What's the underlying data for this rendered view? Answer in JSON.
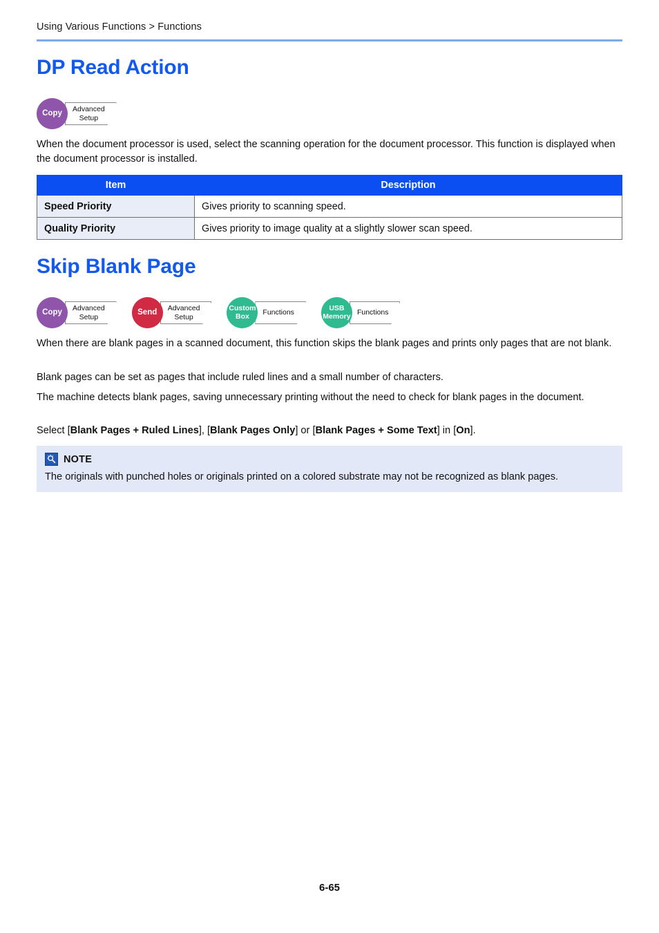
{
  "header": {
    "breadcrumb": "Using Various Functions > Functions"
  },
  "sections": [
    {
      "title": "DP Read Action",
      "badges": [
        {
          "mode": "Copy",
          "mode_color": "#8e55ab",
          "tab": "Advanced\nSetup"
        }
      ],
      "paragraphs": [
        "When the document processor is used, select the scanning operation for the document processor. This function is displayed when the document processor is installed."
      ],
      "table": {
        "headers": [
          "Item",
          "Description"
        ],
        "rows": [
          [
            "Speed Priority",
            "Gives priority to scanning speed."
          ],
          [
            "Quality Priority",
            "Gives priority to image quality at a slightly slower scan speed."
          ]
        ]
      }
    },
    {
      "title": "Skip Blank Page",
      "badges": [
        {
          "mode": "Copy",
          "mode_color": "#8e55ab",
          "tab": "Advanced\nSetup"
        },
        {
          "mode": "Send",
          "mode_color": "#d02a45",
          "tab": "Advanced\nSetup"
        },
        {
          "mode": "Custom\nBox",
          "mode_color": "#2fba8f",
          "tab": "Functions"
        },
        {
          "mode": "USB\nMemory",
          "mode_color": "#2fba8f",
          "tab": "Functions"
        }
      ],
      "paragraphs": [
        "When there are blank pages in a scanned document, this function skips the blank pages and prints only pages that are not blank.",
        "Blank pages can be set as pages that include ruled lines and a small number of characters.",
        "The machine detects blank pages, saving unnecessary printing without the need to check for blank pages in the document."
      ],
      "select_line": {
        "prefix": "Select [",
        "opt1": "Blank Pages + Ruled Lines",
        "sep1": "], [",
        "opt2": "Blank Pages Only",
        "sep2": "] or [",
        "opt3": "Blank Pages + Some Text",
        "sep3": "] in [",
        "opt4": "On",
        "suffix": "]."
      },
      "note": {
        "icon": "note-magnifier-icon",
        "label": "NOTE",
        "text": "The originals with punched holes or originals printed on a colored substrate may not be recognized as blank pages."
      }
    }
  ],
  "footer": {
    "page_number": "6-65"
  },
  "colors": {
    "heading_blue": "#1159ef",
    "rule_blue": "#80abe8",
    "table_header_blue": "#0b4ff2",
    "table_item_bg": "#e9edf8",
    "note_bg": "#e3e8f8",
    "note_icon_blue": "#2558b4"
  }
}
